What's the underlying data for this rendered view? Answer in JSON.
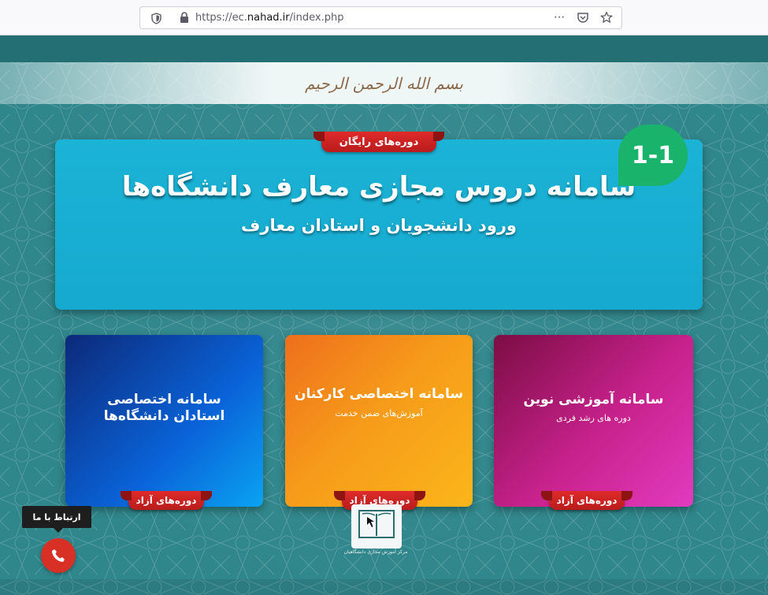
{
  "browser": {
    "url_host_prefix": "https://ec.",
    "url_host_main": "nahad.ir",
    "url_path": "/index.php",
    "more_label": "···"
  },
  "header": {
    "basmala": "بسم الله الرحمن الرحیم"
  },
  "main_card": {
    "ribbon": "دوره‌های رایگان",
    "title": "سامانه دروس مجازی معارف دانشگاه‌ها",
    "subtitle": "ورود دانشجویان و استادان معارف",
    "badge": "1-1"
  },
  "cards": [
    {
      "title": "سامانه آموزشی نوین",
      "subtitle": "دوره های رشد فردی",
      "ribbon": "دوره‌های آزاد"
    },
    {
      "title": "سامانه اختصاصی کارکنان",
      "subtitle": "آموزش‌های ضمن خدمت",
      "ribbon": "دوره‌های آزاد"
    },
    {
      "title": "سامانه اختصاصی استادان دانشگاه‌ها",
      "subtitle": "",
      "ribbon": "دوره‌های آزاد"
    }
  ],
  "footer": {
    "logo_caption": "مرکز آموزش مجازی دانشگاهیان",
    "contact_label": "ارتباط با ما"
  },
  "colors": {
    "page_bg": "#2f868b",
    "main_card": "#1bb3d6",
    "ribbon": "#d32323",
    "badge": "#19b36b",
    "card_blue": "#0a63d8",
    "card_orange": "#f69a1a",
    "card_pink": "#c8228d",
    "phone_button": "#d93025"
  }
}
